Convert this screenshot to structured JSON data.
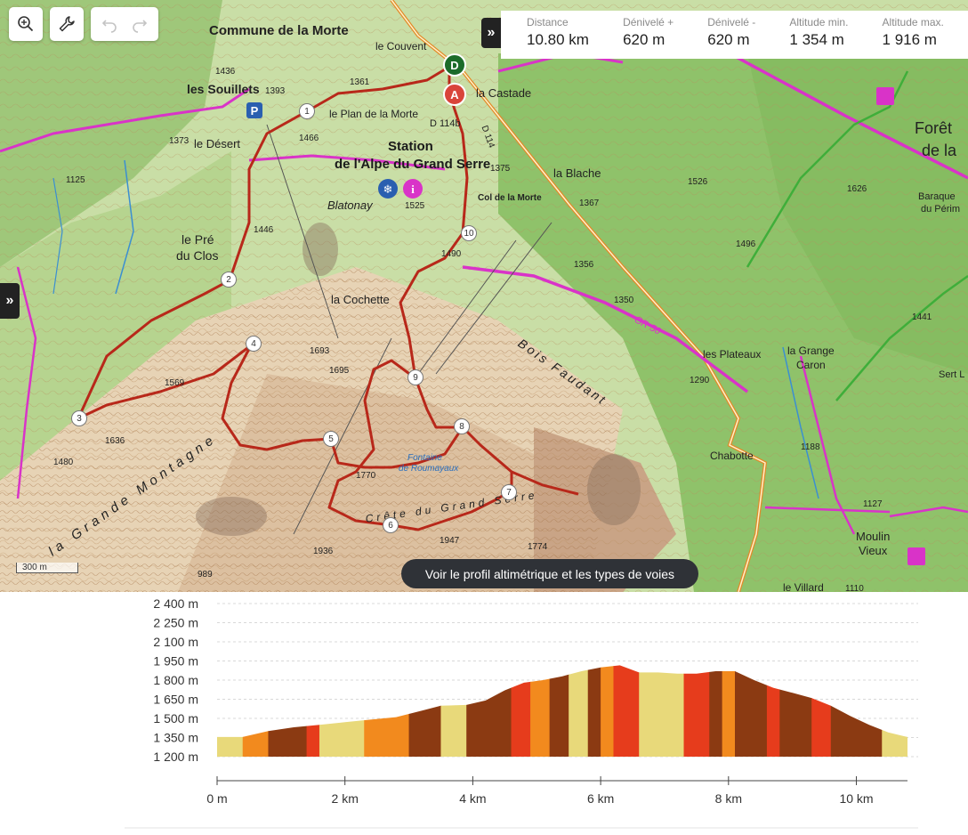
{
  "toolbar": {
    "zoom_icon": "zoom-in-icon",
    "tools_icon": "wrench-icon",
    "undo_icon": "undo-icon",
    "redo_icon": "redo-icon"
  },
  "expand_glyph": "»",
  "stats": [
    {
      "label": "Distance",
      "value": "10.80 km"
    },
    {
      "label": "Dénivelé +",
      "value": "620 m"
    },
    {
      "label": "Dénivelé -",
      "value": "620 m"
    },
    {
      "label": "Altitude min.",
      "value": "1 354 m"
    },
    {
      "label": "Altitude max.",
      "value": "1 916 m"
    }
  ],
  "map": {
    "scale_label": "300 m",
    "profile_button": "Voir le profil altimétrique et les types de voies",
    "start_pin": "D",
    "end_pin": "A",
    "waypoints": [
      "1",
      "2",
      "3",
      "4",
      "5",
      "6",
      "7",
      "8",
      "9",
      "10"
    ],
    "place_labels": {
      "commune": "Commune de la Morte",
      "souillets": "les Souillets",
      "desert": "le Désert",
      "station1": "Station",
      "station2": "de l'Alpe du Grand Serre",
      "plan": "le Plan de la Morte",
      "couvent": "le Couvent",
      "castade": "la Castade",
      "blache": "la Blache",
      "col": "Col de la Morte",
      "blatonay": "Blatonay",
      "pre1": "le Pré",
      "pre2": "du Clos",
      "cochette": "la Cochette",
      "bois": "Bois Faudant",
      "plateaux": "les Plateaux",
      "grange1": "la Grange",
      "grange2": "Caron",
      "chabotte": "Chabotte",
      "grande": "la Grande Montagne",
      "crete": "Crête du Grand Serre",
      "fontaine1": "Fontaine",
      "fontaine2": "de Roumayaux",
      "foret1": "Forêt",
      "foret2": "de la",
      "moulin1": "Moulin",
      "moulin2": "Vieux",
      "villard": "le Villard",
      "gr": "GR 50",
      "d114b": "D 114b",
      "d114": "D 114",
      "baraque1": "Baraque",
      "baraque2": "du Périm",
      "sert": "Sert L",
      "e1436": "1436",
      "e1393": "1393",
      "e1361": "1361",
      "e1466": "1466",
      "e1525": "1525",
      "e1446": "1446",
      "e1490": "1490",
      "e1356": "1356",
      "e1350": "1350",
      "e1375": "1375",
      "e1367": "1367",
      "e1569": "1569",
      "e1636": "1636",
      "e1480": "1480",
      "e1693": "1693",
      "e1695": "1695",
      "e1770": "1770",
      "e1947": "1947",
      "e1936": "1936",
      "e1774": "1774",
      "e1290": "1290",
      "e1188": "1188",
      "e1127": "1127",
      "e1441": "1441",
      "e1526": "1526",
      "e1496": "1496",
      "e1626": "1626",
      "e1373": "1373",
      "e1125": "1125",
      "e989": "989",
      "e1110": "1110"
    }
  },
  "chart_data": {
    "type": "area",
    "title": "",
    "xlabel": "",
    "ylabel": "",
    "ylim": [
      1200,
      2400
    ],
    "xlim": [
      0,
      10.8
    ],
    "y_ticks": [
      {
        "v": 1200,
        "label": "1 200 m"
      },
      {
        "v": 1350,
        "label": "1 350 m"
      },
      {
        "v": 1500,
        "label": "1 500 m"
      },
      {
        "v": 1650,
        "label": "1 650 m"
      },
      {
        "v": 1800,
        "label": "1 800 m"
      },
      {
        "v": 1950,
        "label": "1 950 m"
      },
      {
        "v": 2100,
        "label": "2 100 m"
      },
      {
        "v": 2250,
        "label": "2 250 m"
      },
      {
        "v": 2400,
        "label": "2 400 m"
      }
    ],
    "x_ticks": [
      {
        "v": 0,
        "label": "0 m"
      },
      {
        "v": 2,
        "label": "2 km"
      },
      {
        "v": 4,
        "label": "4 km"
      },
      {
        "v": 6,
        "label": "6 km"
      },
      {
        "v": 8,
        "label": "8 km"
      },
      {
        "v": 10,
        "label": "10 km"
      }
    ],
    "x": [
      0,
      0.4,
      0.8,
      1.2,
      1.6,
      2.0,
      2.4,
      2.8,
      3.2,
      3.5,
      3.9,
      4.2,
      4.5,
      4.8,
      5.1,
      5.4,
      5.7,
      6.0,
      6.3,
      6.6,
      6.9,
      7.2,
      7.5,
      7.8,
      8.1,
      8.4,
      8.7,
      9.0,
      9.3,
      9.6,
      9.9,
      10.2,
      10.5,
      10.8
    ],
    "values": [
      1354,
      1354,
      1400,
      1430,
      1450,
      1470,
      1490,
      1510,
      1560,
      1600,
      1605,
      1640,
      1720,
      1780,
      1800,
      1830,
      1870,
      1900,
      1916,
      1860,
      1860,
      1850,
      1850,
      1870,
      1870,
      1800,
      1740,
      1700,
      1660,
      1600,
      1520,
      1450,
      1390,
      1354
    ],
    "segment_colors": {
      "path": "#8b3a12",
      "trail": "#e8d97a",
      "road": "#f28a1e",
      "track": "#e63c1c"
    },
    "segments": [
      [
        0,
        0.4,
        "trail"
      ],
      [
        0.4,
        0.8,
        "road"
      ],
      [
        0.8,
        1.4,
        "path"
      ],
      [
        1.4,
        1.6,
        "track"
      ],
      [
        1.6,
        2.3,
        "trail"
      ],
      [
        2.3,
        3.0,
        "road"
      ],
      [
        3.0,
        3.5,
        "path"
      ],
      [
        3.5,
        3.9,
        "trail"
      ],
      [
        3.9,
        4.6,
        "path"
      ],
      [
        4.6,
        4.9,
        "track"
      ],
      [
        4.9,
        5.2,
        "road"
      ],
      [
        5.2,
        5.5,
        "path"
      ],
      [
        5.5,
        5.8,
        "trail"
      ],
      [
        5.8,
        6.0,
        "path"
      ],
      [
        6.0,
        6.2,
        "road"
      ],
      [
        6.2,
        6.6,
        "track"
      ],
      [
        6.6,
        7.3,
        "trail"
      ],
      [
        7.3,
        7.7,
        "track"
      ],
      [
        7.7,
        7.9,
        "path"
      ],
      [
        7.9,
        8.1,
        "road"
      ],
      [
        8.1,
        8.6,
        "path"
      ],
      [
        8.6,
        8.8,
        "track"
      ],
      [
        8.8,
        9.3,
        "path"
      ],
      [
        9.3,
        9.6,
        "track"
      ],
      [
        9.6,
        10.4,
        "path"
      ],
      [
        10.4,
        10.8,
        "trail"
      ]
    ]
  }
}
